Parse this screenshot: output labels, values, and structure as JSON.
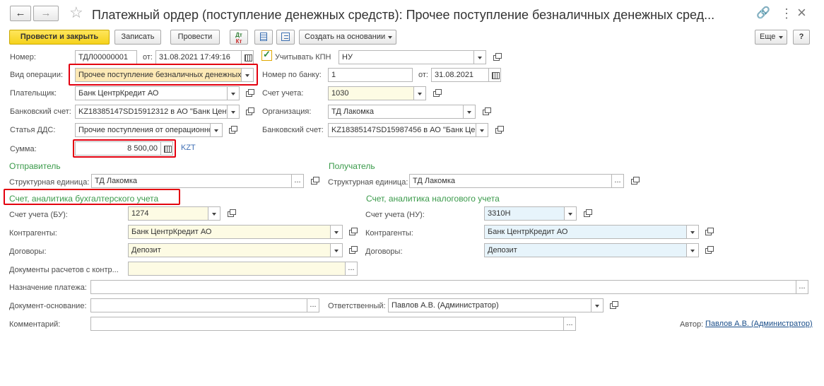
{
  "window": {
    "title": "Платежный ордер (поступление денежных средств): Прочее поступление безналичных денежных сред...",
    "more_glyph": "⋮",
    "close_glyph": "×"
  },
  "toolbar": {
    "post_close": "Провести и закрыть",
    "save": "Записать",
    "post": "Провести",
    "create_based": "Создать на основании",
    "more": "Еще",
    "help": "?"
  },
  "header": {
    "number_label": "Номер:",
    "number_value": "ТДЛ00000001",
    "from_label": "от:",
    "date_value": "31.08.2021 17:49:16",
    "kpn_label": "Учитывать КПН",
    "kpn_value": "НУ",
    "op_label": "Вид операции:",
    "op_value": "Прочее поступление безналичных денежных",
    "bank_num_label": "Номер по банку:",
    "bank_num_value": "1",
    "bank_from_label": "от:",
    "bank_date_value": "31.08.2021",
    "payer_label": "Плательщик:",
    "payer_value": "Банк ЦентрКредит АО",
    "account_label": "Счет учета:",
    "account_value": "1030",
    "bank_acc_label": "Банковский счет:",
    "bank_acc_value": "KZ18385147SD15912312 в АО \"Банк Центр",
    "org_label": "Организация:",
    "org_value": "ТД Лакомка",
    "dds_label": "Статья ДДС:",
    "dds_value": "Прочие поступления от операционно",
    "bank_acc2_label": "Банковский счет:",
    "bank_acc2_value": "KZ18385147SD15987456 в АО \"Банк Це",
    "sum_label": "Сумма:",
    "sum_value": "8 500,00",
    "currency": "KZT"
  },
  "sender": {
    "title": "Отправитель",
    "unit_label": "Структурная единица:",
    "unit_value": "ТД Лакомка"
  },
  "receiver": {
    "title": "Получатель",
    "unit_label": "Структурная единица:",
    "unit_value": "ТД Лакомка"
  },
  "bu": {
    "title": "Счет, аналитика бухгалтерского учета",
    "account_label": "Счет учета (БУ):",
    "account_value": "1274",
    "contractors_label": "Контрагенты:",
    "contractors_value": "Банк ЦентрКредит АО",
    "contracts_label": "Договоры:",
    "contracts_value": "Депозит",
    "docs_label": "Документы расчетов с контр...",
    "docs_value": ""
  },
  "nu": {
    "title": "Счет, аналитика налогового учета",
    "account_label": "Счет учета (НУ):",
    "account_value": "3310Н",
    "contractors_label": "Контрагенты:",
    "contractors_value": "Банк ЦентрКредит АО",
    "contracts_label": "Договоры:",
    "contracts_value": "Депозит"
  },
  "footer": {
    "purpose_label": "Назначение платежа:",
    "basis_label": "Документ-основание:",
    "responsible_label": "Ответственный:",
    "responsible_value": "Павлов А.В. (Администратор)",
    "comment_label": "Комментарий:",
    "author_label": "Автор:",
    "author_value": "Павлов А.В. (Администратор)"
  },
  "colors": {
    "accent": "#f5d21c",
    "section": "#3a9a4a",
    "highlight": "#e3000f",
    "link": "#1a4e8a"
  }
}
